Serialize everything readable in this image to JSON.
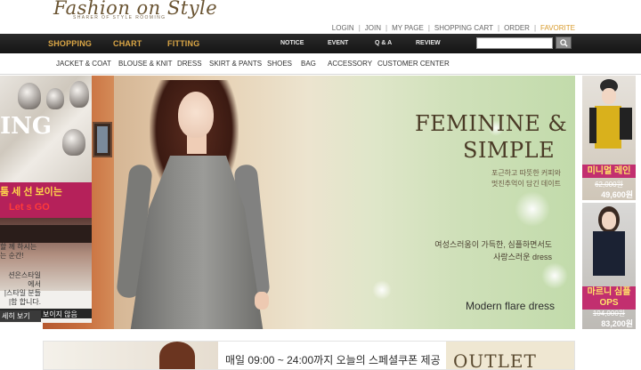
{
  "brand": {
    "logo_text": "Fashion on Style",
    "tagline": "SHARER OF STYLE ROOMING"
  },
  "top_nav": {
    "items": [
      "LOGIN",
      "JOIN",
      "MY PAGE",
      "SHOPPING CART",
      "ORDER",
      "FAVORITE"
    ]
  },
  "main_nav": {
    "primary": [
      "SHOPPING",
      "CHART",
      "FITTING"
    ],
    "secondary": [
      "NOTICE",
      "EVENT",
      "Q & A",
      "REVIEW"
    ],
    "search_placeholder": ""
  },
  "categories": [
    "JACKET & COAT",
    "BLOUSE & KNIT",
    "DRESS",
    "SKIRT & PANTS",
    "SHOES",
    "BAG",
    "ACCESSORY",
    "CUSTOMER CENTER"
  ],
  "left_promo": {
    "headline": "ING",
    "pink_line1": "툼 세 선 보이는",
    "pink_line2": "Let s GO",
    "close_text": "오늘 하루 보이지 않음",
    "side_lines": [
      "할 께 하시는",
      "는 순간!"
    ],
    "side_lines2": [
      "션은스타일",
      "에서",
      "|스타일 분들",
      "|함 합니다."
    ],
    "side_more": "세히 보기"
  },
  "banner": {
    "title_line1": "FEMININE &",
    "title_line2": "SIMPLE",
    "sub_line1": "포근하고 따뜻한 커피와",
    "sub_line2": "멋진추억이 담긴 데이트",
    "copy_line1": "여성스러움이 가득한, 심플하면서도",
    "copy_line2": "사랑스러운 dress",
    "model_name": "Modern flare dress"
  },
  "right_products": [
    {
      "name": "미니멀 레인",
      "old_price": "62,000원",
      "new_price": "49,600원"
    },
    {
      "name": "마르니 심플",
      "name2": "OPS",
      "old_price": "104,000원",
      "new_price": "83,200원"
    }
  ],
  "bottom_strip": {
    "notice": "매일 09:00 ~ 24:00까지 오늘의 스페셜쿠폰 제공",
    "outlet": "OUTLET"
  },
  "colors": {
    "accent_gold": "#d9a545",
    "nav_dark": "#1a1a1a",
    "promo_pink": "#c22f6f"
  }
}
